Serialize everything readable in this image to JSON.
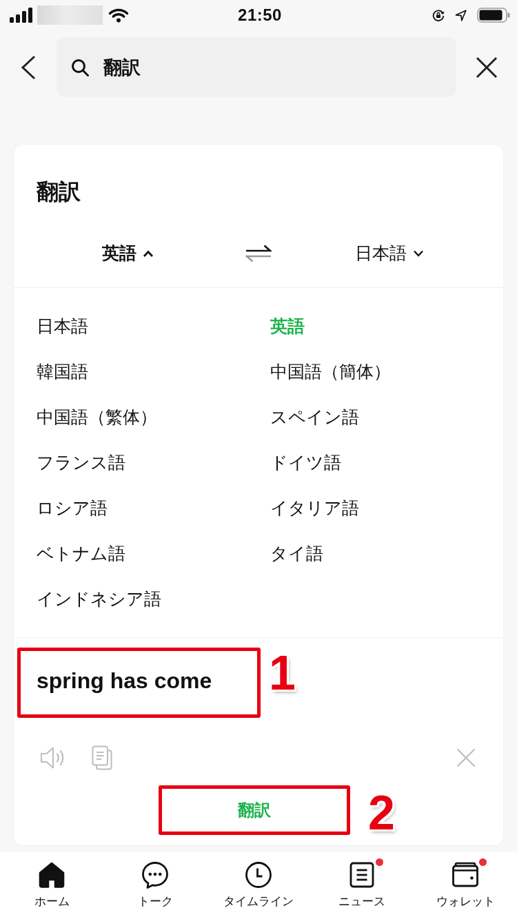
{
  "status_bar": {
    "time": "21:50"
  },
  "search": {
    "value": "翻訳"
  },
  "card": {
    "title": "翻訳",
    "source_language": {
      "label": "英語",
      "expanded": true
    },
    "target_language": {
      "label": "日本語",
      "expanded": false
    },
    "languages": [
      {
        "label": "日本語",
        "selected": false
      },
      {
        "label": "英語",
        "selected": true
      },
      {
        "label": "韓国語",
        "selected": false
      },
      {
        "label": "中国語（簡体）",
        "selected": false
      },
      {
        "label": "中国語（繁体）",
        "selected": false
      },
      {
        "label": "スペイン語",
        "selected": false
      },
      {
        "label": "フランス語",
        "selected": false
      },
      {
        "label": "ドイツ語",
        "selected": false
      },
      {
        "label": "ロシア語",
        "selected": false
      },
      {
        "label": "イタリア語",
        "selected": false
      },
      {
        "label": "ベトナム語",
        "selected": false
      },
      {
        "label": "タイ語",
        "selected": false
      },
      {
        "label": "インドネシア語",
        "selected": false
      }
    ],
    "input": {
      "text": "spring has come",
      "annotation": "1"
    },
    "translate_button": {
      "label": "翻訳",
      "annotation": "2"
    }
  },
  "tab_bar": [
    {
      "kind": "home",
      "label": "ホーム",
      "selected": true,
      "badge": false
    },
    {
      "kind": "talk",
      "label": "トーク",
      "selected": false,
      "badge": false
    },
    {
      "kind": "timeline",
      "label": "タイムライン",
      "selected": false,
      "badge": false
    },
    {
      "kind": "news",
      "label": "ニュース",
      "selected": false,
      "badge": true
    },
    {
      "kind": "wallet",
      "label": "ウォレット",
      "selected": false,
      "badge": true
    }
  ]
}
